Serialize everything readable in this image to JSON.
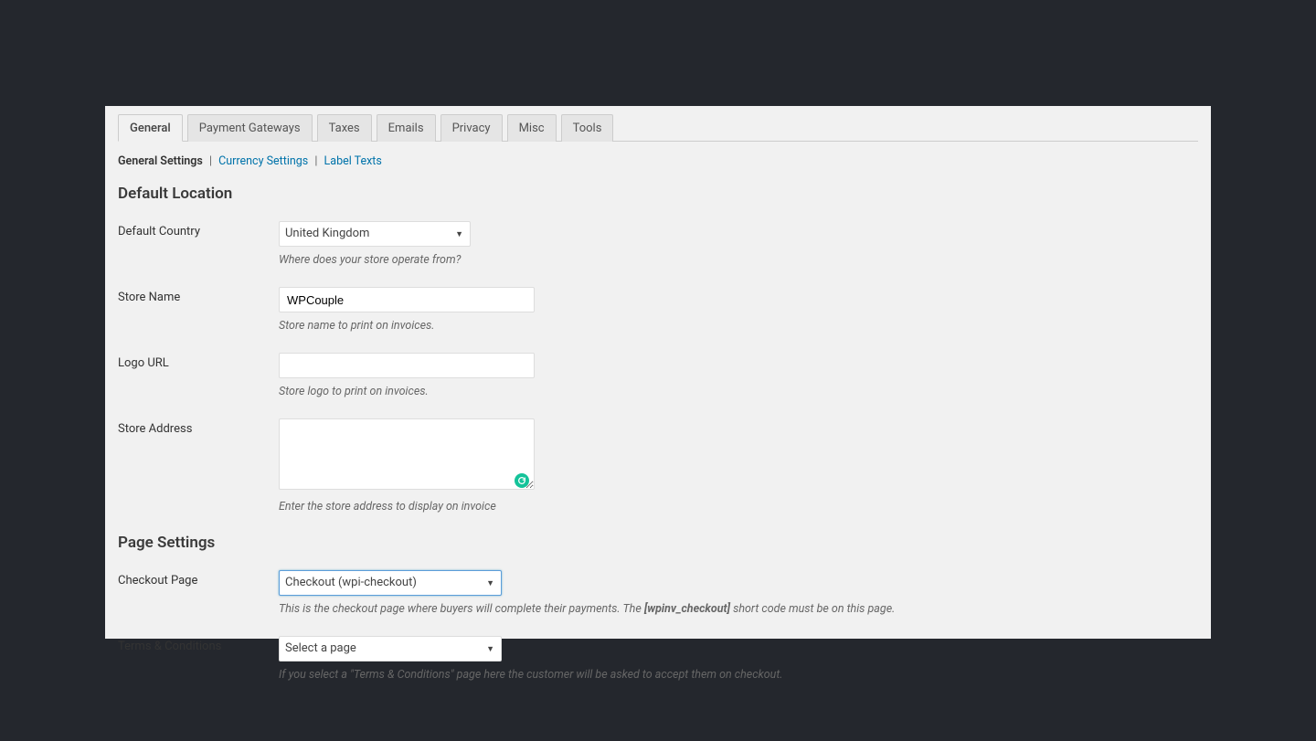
{
  "tabs": {
    "general": "General",
    "gateways": "Payment Gateways",
    "taxes": "Taxes",
    "emails": "Emails",
    "privacy": "Privacy",
    "misc": "Misc",
    "tools": "Tools"
  },
  "subtabs": {
    "general_settings": "General Settings",
    "currency_settings": "Currency Settings",
    "label_texts": "Label Texts",
    "divider": "|"
  },
  "sections": {
    "default_location": "Default Location",
    "page_settings": "Page Settings"
  },
  "fields": {
    "default_country": {
      "label": "Default Country",
      "value": "United Kingdom",
      "helper": "Where does your store operate from?"
    },
    "store_name": {
      "label": "Store Name",
      "value": "WPCouple",
      "helper": "Store name to print on invoices."
    },
    "logo_url": {
      "label": "Logo URL",
      "value": "",
      "helper": "Store logo to print on invoices."
    },
    "store_address": {
      "label": "Store Address",
      "value": "",
      "helper": "Enter the store address to display on invoice"
    },
    "checkout_page": {
      "label": "Checkout Page",
      "value": "Checkout (wpi-checkout)",
      "helper_pre": "This is the checkout page where buyers will complete their payments. The ",
      "helper_code": "[wpinv_checkout]",
      "helper_post": " short code must be on this page."
    },
    "terms": {
      "label": "Terms & Conditions",
      "value": "Select a page",
      "helper": "If you select a \"Terms & Conditions\" page here the customer will be asked to accept them on checkout."
    }
  }
}
